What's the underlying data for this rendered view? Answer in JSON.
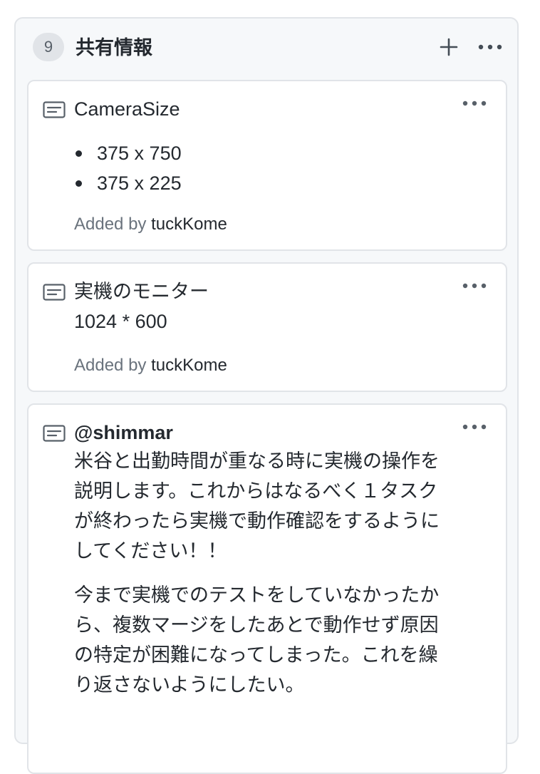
{
  "column": {
    "count": "9",
    "title": "共有情報",
    "add_icon": "plus-icon",
    "more_icon": "kebab-horizontal-icon"
  },
  "cards": [
    {
      "icon": "note-icon",
      "title": "CameraSize",
      "items": [
        "375 x 750",
        "375 x 225"
      ],
      "added_by_label": "Added by",
      "added_by_user": "tuckKome"
    },
    {
      "icon": "note-icon",
      "title": "実機のモニター",
      "body": "1024 * 600",
      "added_by_label": "Added by",
      "added_by_user": "tuckKome"
    },
    {
      "icon": "note-icon",
      "title": "@shimmar",
      "paragraphs": [
        [
          "米谷と出勤時間が重なる時に実機の操作を",
          "説明します。これからはなるべく１タスク",
          "が終わったら実機で動作確認をするように",
          "してください！！"
        ],
        [
          "今まで実機でのテストをしていなかったか",
          "ら、複数マージをしたあとで動作せず原因",
          "の特定が困難になってしまった。これを繰",
          "り返さないようにしたい。"
        ]
      ]
    }
  ]
}
